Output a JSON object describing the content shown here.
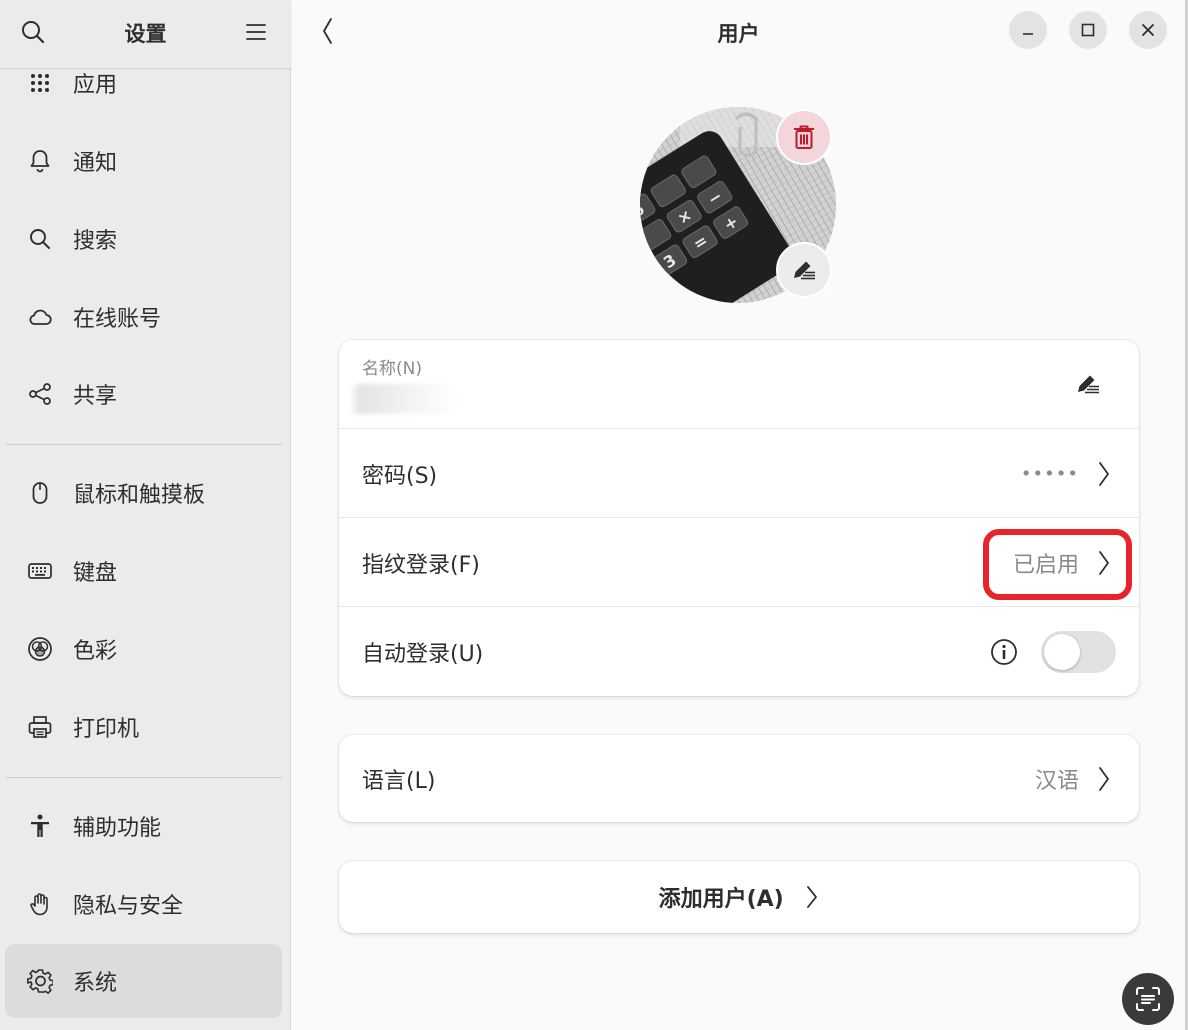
{
  "sidebar": {
    "title": "设置",
    "items": [
      {
        "label": "应用",
        "icon": "apps-grid-icon"
      },
      {
        "label": "通知",
        "icon": "bell-icon"
      },
      {
        "label": "搜索",
        "icon": "search-icon"
      },
      {
        "label": "在线账号",
        "icon": "cloud-icon"
      },
      {
        "label": "共享",
        "icon": "share-icon"
      },
      {
        "label": "鼠标和触摸板",
        "icon": "mouse-icon"
      },
      {
        "label": "键盘",
        "icon": "keyboard-icon"
      },
      {
        "label": "色彩",
        "icon": "color-icon"
      },
      {
        "label": "打印机",
        "icon": "printer-icon"
      },
      {
        "label": "辅助功能",
        "icon": "accessibility-icon"
      },
      {
        "label": "隐私与安全",
        "icon": "hand-icon"
      },
      {
        "label": "系统",
        "icon": "gear-icon"
      }
    ],
    "active": "系统"
  },
  "header": {
    "title": "用户"
  },
  "user_card": {
    "name_caption": "名称(N)",
    "password_label": "密码(S)",
    "password_value": "•••••",
    "fingerprint_label": "指纹登录(F)",
    "fingerprint_value": "已启用",
    "autologin_label": "自动登录(U)",
    "autologin_enabled": false
  },
  "language": {
    "label": "语言(L)",
    "value": "汉语"
  },
  "add_user": {
    "label": "添加用户(A)"
  },
  "colors": {
    "accent_red": "#e8232b",
    "delete_pink": "#f3d6db",
    "delete_icon": "#c01c28"
  }
}
